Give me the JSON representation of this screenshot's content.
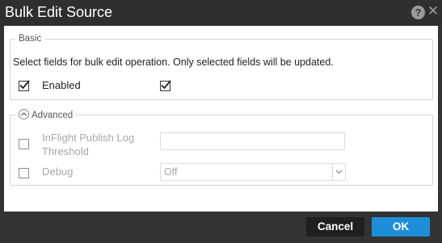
{
  "dialog": {
    "title": "Bulk Edit Source",
    "help_glyph": "?",
    "close_glyph": "✕"
  },
  "basic": {
    "legend": "Basic",
    "description": "Select fields for bulk edit operation. Only selected fields will be updated.",
    "enabled_label": "Enabled",
    "enabled_selected": true,
    "enabled_value": true
  },
  "advanced": {
    "legend": "Advanced",
    "expanded": true,
    "threshold_label_line1": "InFlight Publish Log",
    "threshold_label_line2": "Threshold",
    "threshold_value": "",
    "debug_label": "Debug",
    "debug_value": "Off"
  },
  "footer": {
    "cancel_label": "Cancel",
    "ok_label": "OK"
  },
  "colors": {
    "ok_button": "#1f8ed8",
    "cancel_button": "#1f1f1f",
    "titlebar": "#2f2f2f"
  }
}
